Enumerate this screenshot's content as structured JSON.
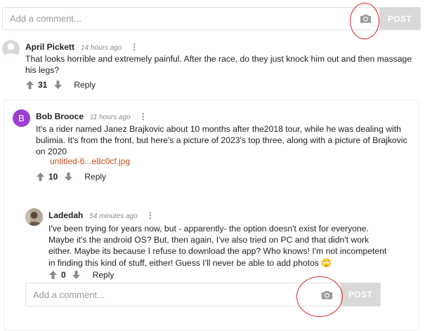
{
  "top_comment_box": {
    "placeholder": "Add a comment...",
    "post_label": "POST"
  },
  "comments": [
    {
      "author": "April Pickett",
      "time": "14 hours ago",
      "text": "That looks horrible and extremely painful. After the race, do they just knock him out and then massage his legs?",
      "votes": "31",
      "reply_label": "Reply",
      "avatar": {
        "type": "default",
        "color": "#d8d8d8"
      }
    },
    {
      "author": "Bob Brooce",
      "time": "11 hours ago",
      "text": "It's a rider named Janez Brajkovic about 10 months after the2018 tour, while he was dealing with bulimia. It's from the front, but here's a picture of 2023's top three, along with a picture of Brajkovic on 2020",
      "attachment": "untitled-6...e8c0cf.jpg",
      "votes": "10",
      "reply_label": "Reply",
      "avatar": {
        "type": "letter",
        "letter": "B",
        "color": "#9c3fd0"
      }
    },
    {
      "author": "Ladedah",
      "time": "54 minutes ago",
      "text": "I've been trying for years now, but - apparently- the option doesn't exist for everyone. Maybe it's the android OS? But, then again, I've also tried on PC and that didn't work either. Maybe its because I refuse to download the app? Who knows! I'm not incompetent in finding this kind of stuff, either! Guess I'll never be able to add photos 🙄",
      "votes": "0",
      "reply_label": "Reply",
      "avatar": {
        "type": "image",
        "color": "#8a7a6a"
      }
    }
  ],
  "reply_comment_box": {
    "placeholder": "Add a comment...",
    "post_label": "POST"
  },
  "colors": {
    "highlight_circle": "#d4242a",
    "attachment_link": "#c2501e",
    "post_button": "#d9d9d9"
  },
  "icons": [
    "camera-icon",
    "upvote-icon",
    "downvote-icon",
    "more-options-icon",
    "default-avatar-icon"
  ]
}
